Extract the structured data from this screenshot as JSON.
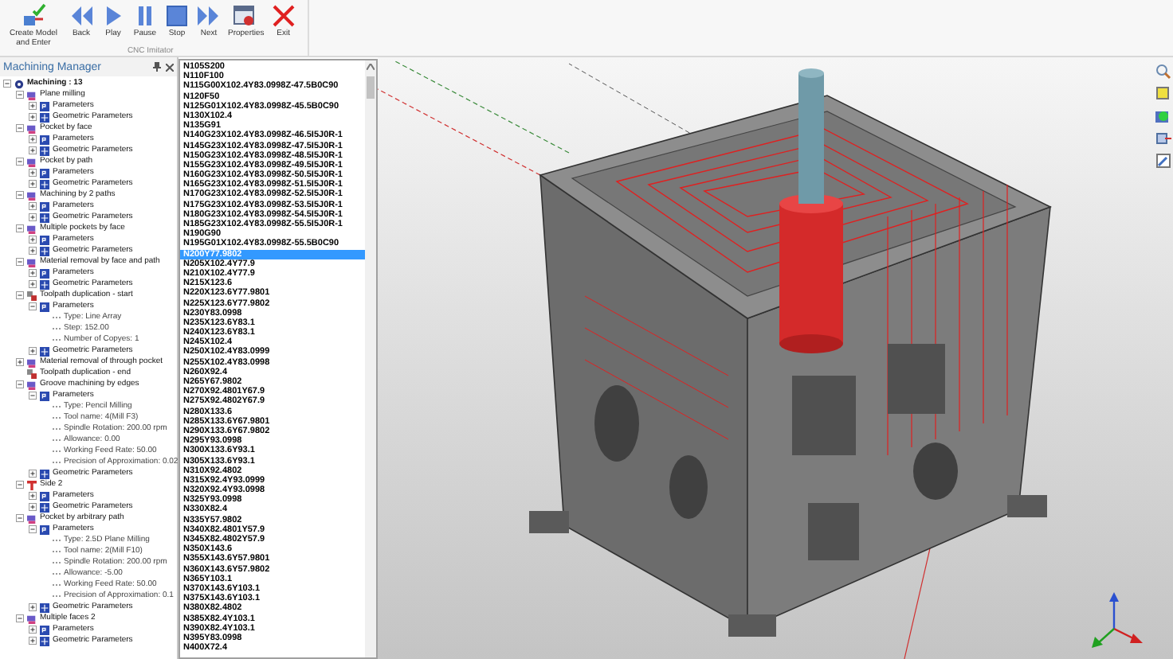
{
  "toolbar": {
    "buttons": [
      {
        "label": "Create Model and Enter",
        "kind": "create"
      },
      {
        "label": "Back",
        "kind": "back"
      },
      {
        "label": "Play",
        "kind": "play"
      },
      {
        "label": "Pause",
        "kind": "pause"
      },
      {
        "label": "Stop",
        "kind": "stop"
      },
      {
        "label": "Next",
        "kind": "next"
      },
      {
        "label": "Properties",
        "kind": "properties"
      },
      {
        "label": "Exit",
        "kind": "exit"
      }
    ],
    "group_label": "CNC Imitator"
  },
  "panel": {
    "title": "Machining Manager",
    "tree": [
      {
        "label": "Machining : 13",
        "kind": "machining",
        "expanded": true,
        "children": [
          {
            "label": "Plane milling",
            "kind": "operation",
            "expanded": true,
            "children": [
              {
                "label": "Parameters",
                "kind": "parameters",
                "expanded": false
              },
              {
                "label": "Geometric Parameters",
                "kind": "geometry",
                "expanded": false
              }
            ]
          },
          {
            "label": "Pocket by face",
            "kind": "operation",
            "expanded": true,
            "children": [
              {
                "label": "Parameters",
                "kind": "parameters",
                "expanded": false
              },
              {
                "label": "Geometric Parameters",
                "kind": "geometry",
                "expanded": false
              }
            ]
          },
          {
            "label": "Pocket by path",
            "kind": "operation",
            "expanded": true,
            "children": [
              {
                "label": "Parameters",
                "kind": "parameters",
                "expanded": false
              },
              {
                "label": "Geometric Parameters",
                "kind": "geometry",
                "expanded": false
              }
            ]
          },
          {
            "label": "Machining by 2 paths",
            "kind": "operation",
            "expanded": true,
            "children": [
              {
                "label": "Parameters",
                "kind": "parameters",
                "expanded": false
              },
              {
                "label": "Geometric Parameters",
                "kind": "geometry",
                "expanded": false
              }
            ]
          },
          {
            "label": "Multiple pockets by face",
            "kind": "operation",
            "expanded": true,
            "children": [
              {
                "label": "Parameters",
                "kind": "parameters",
                "expanded": false
              },
              {
                "label": "Geometric Parameters",
                "kind": "geometry",
                "expanded": false
              }
            ]
          },
          {
            "label": "Material removal by face and path",
            "kind": "operation",
            "expanded": true,
            "children": [
              {
                "label": "Parameters",
                "kind": "parameters",
                "expanded": false
              },
              {
                "label": "Geometric Parameters",
                "kind": "geometry",
                "expanded": false
              }
            ]
          },
          {
            "label": "Toolpath duplication - start",
            "kind": "duplication",
            "expanded": true,
            "children": [
              {
                "label": "Parameters",
                "kind": "parameters",
                "expanded": true,
                "children": [
                  {
                    "label": "Type: Line Array",
                    "kind": "property"
                  },
                  {
                    "label": "Step: 152.00",
                    "kind": "property"
                  },
                  {
                    "label": "Number of Copyes: 1",
                    "kind": "property"
                  }
                ]
              },
              {
                "label": "Geometric Parameters",
                "kind": "geometry",
                "expanded": false
              }
            ]
          },
          {
            "label": "Material removal of through pocket",
            "kind": "operation",
            "expanded": false
          },
          {
            "label": "Toolpath duplication - end",
            "kind": "duplication"
          },
          {
            "label": "Groove machining by edges",
            "kind": "operation",
            "expanded": true,
            "children": [
              {
                "label": "Parameters",
                "kind": "parameters",
                "expanded": true,
                "children": [
                  {
                    "label": "Type: Pencil Milling",
                    "kind": "property"
                  },
                  {
                    "label": "Tool name: 4(Mill F3)",
                    "kind": "property"
                  },
                  {
                    "label": "Spindle Rotation: 200.00 rpm",
                    "kind": "property"
                  },
                  {
                    "label": "Allowance: 0.00",
                    "kind": "property"
                  },
                  {
                    "label": "Working Feed Rate: 50.00",
                    "kind": "property"
                  },
                  {
                    "label": "Precision of Approximation: 0.02",
                    "kind": "property"
                  }
                ]
              },
              {
                "label": "Geometric Parameters",
                "kind": "geometry",
                "expanded": false
              }
            ]
          },
          {
            "label": "Side 2",
            "kind": "side",
            "expanded": true,
            "children": [
              {
                "label": "Parameters",
                "kind": "parameters",
                "expanded": false
              },
              {
                "label": "Geometric Parameters",
                "kind": "geometry",
                "expanded": false
              }
            ]
          },
          {
            "label": "Pocket by arbitrary path",
            "kind": "operation",
            "expanded": true,
            "children": [
              {
                "label": "Parameters",
                "kind": "parameters",
                "expanded": true,
                "children": [
                  {
                    "label": "Type: 2.5D Plane Milling",
                    "kind": "property"
                  },
                  {
                    "label": "Tool name: 2(Mill F10)",
                    "kind": "property"
                  },
                  {
                    "label": "Spindle Rotation: 200.00 rpm",
                    "kind": "property"
                  },
                  {
                    "label": "Allowance: -5.00",
                    "kind": "property"
                  },
                  {
                    "label": "Working Feed Rate: 50.00",
                    "kind": "property"
                  },
                  {
                    "label": "Precision of Approximation: 0.1",
                    "kind": "property"
                  }
                ]
              },
              {
                "label": "Geometric Parameters",
                "kind": "geometry",
                "expanded": false
              }
            ]
          },
          {
            "label": "Multiple faces 2",
            "kind": "operation",
            "expanded": true,
            "children": [
              {
                "label": "Parameters",
                "kind": "parameters",
                "expanded": false
              },
              {
                "label": "Geometric Parameters",
                "kind": "geometry",
                "expanded": false
              }
            ]
          }
        ]
      }
    ]
  },
  "nc_program": {
    "lines": [
      {
        "text": "N105S200",
        "selected": false
      },
      {
        "text": "N110F100",
        "selected": false
      },
      {
        "text": "N115G00X102.4Y83.0998Z-47.5B0C90",
        "selected": false
      },
      {
        "text": "N120F50",
        "selected": false
      },
      {
        "text": "N125G01X102.4Y83.0998Z-45.5B0C90",
        "selected": false
      },
      {
        "text": "N130X102.4",
        "selected": false
      },
      {
        "text": "N135G91",
        "selected": false
      },
      {
        "text": "N140G23X102.4Y83.0998Z-46.5I5J0R-1",
        "selected": false
      },
      {
        "text": "N145G23X102.4Y83.0998Z-47.5I5J0R-1",
        "selected": false
      },
      {
        "text": "N150G23X102.4Y83.0998Z-48.5I5J0R-1",
        "selected": false
      },
      {
        "text": "N155G23X102.4Y83.0998Z-49.5I5J0R-1",
        "selected": false
      },
      {
        "text": "N160G23X102.4Y83.0998Z-50.5I5J0R-1",
        "selected": false
      },
      {
        "text": "N165G23X102.4Y83.0998Z-51.5I5J0R-1",
        "selected": false
      },
      {
        "text": "N170G23X102.4Y83.0998Z-52.5I5J0R-1",
        "selected": false
      },
      {
        "text": "N175G23X102.4Y83.0998Z-53.5I5J0R-1",
        "selected": false
      },
      {
        "text": "N180G23X102.4Y83.0998Z-54.5I5J0R-1",
        "selected": false
      },
      {
        "text": "N185G23X102.4Y83.0998Z-55.5I5J0R-1",
        "selected": false
      },
      {
        "text": "N190G90",
        "selected": false
      },
      {
        "text": "N195G01X102.4Y83.0998Z-55.5B0C90",
        "selected": false
      },
      {
        "text": "N200Y77.9802",
        "selected": true
      },
      {
        "text": "N205X102.4Y77.9",
        "selected": false
      },
      {
        "text": "N210X102.4Y77.9",
        "selected": false
      },
      {
        "text": "N215X123.6",
        "selected": false
      },
      {
        "text": "N220X123.6Y77.9801",
        "selected": false
      },
      {
        "text": "N225X123.6Y77.9802",
        "selected": false
      },
      {
        "text": "N230Y83.0998",
        "selected": false
      },
      {
        "text": "N235X123.6Y83.1",
        "selected": false
      },
      {
        "text": "N240X123.6Y83.1",
        "selected": false
      },
      {
        "text": "N245X102.4",
        "selected": false
      },
      {
        "text": "N250X102.4Y83.0999",
        "selected": false
      },
      {
        "text": "N255X102.4Y83.0998",
        "selected": false
      },
      {
        "text": "N260X92.4",
        "selected": false
      },
      {
        "text": "N265Y67.9802",
        "selected": false
      },
      {
        "text": "N270X92.4801Y67.9",
        "selected": false
      },
      {
        "text": "N275X92.4802Y67.9",
        "selected": false
      },
      {
        "text": "N280X133.6",
        "selected": false
      },
      {
        "text": "N285X133.6Y67.9801",
        "selected": false
      },
      {
        "text": "N290X133.6Y67.9802",
        "selected": false
      },
      {
        "text": "N295Y93.0998",
        "selected": false
      },
      {
        "text": "N300X133.6Y93.1",
        "selected": false
      },
      {
        "text": "N305X133.6Y93.1",
        "selected": false
      },
      {
        "text": "N310X92.4802",
        "selected": false
      },
      {
        "text": "N315X92.4Y93.0999",
        "selected": false
      },
      {
        "text": "N320X92.4Y93.0998",
        "selected": false
      },
      {
        "text": "N325Y93.0998",
        "selected": false
      },
      {
        "text": "N330X82.4",
        "selected": false
      },
      {
        "text": "N335Y57.9802",
        "selected": false
      },
      {
        "text": "N340X82.4801Y57.9",
        "selected": false
      },
      {
        "text": "N345X82.4802Y57.9",
        "selected": false
      },
      {
        "text": "N350X143.6",
        "selected": false
      },
      {
        "text": "N355X143.6Y57.9801",
        "selected": false
      },
      {
        "text": "N360X143.6Y57.9802",
        "selected": false
      },
      {
        "text": "N365Y103.1",
        "selected": false
      },
      {
        "text": "N370X143.6Y103.1",
        "selected": false
      },
      {
        "text": "N375X143.6Y103.1",
        "selected": false
      },
      {
        "text": "N380X82.4802",
        "selected": false
      },
      {
        "text": "N385X82.4Y103.1",
        "selected": false
      },
      {
        "text": "N390X82.4Y103.1",
        "selected": false
      },
      {
        "text": "N395Y83.0998",
        "selected": false
      },
      {
        "text": "N400X72.4",
        "selected": false
      }
    ]
  }
}
